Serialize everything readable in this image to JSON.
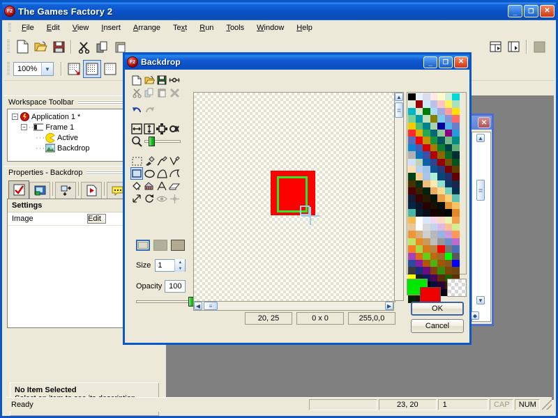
{
  "app": {
    "title": "The Games Factory 2",
    "icon": "app-f2-icon",
    "window_buttons": [
      "minimize",
      "maximize",
      "close"
    ]
  },
  "menubar": {
    "items": [
      {
        "label": "File",
        "mnemonic": "F"
      },
      {
        "label": "Edit",
        "mnemonic": "E"
      },
      {
        "label": "View",
        "mnemonic": "V"
      },
      {
        "label": "Insert",
        "mnemonic": "I"
      },
      {
        "label": "Arrange",
        "mnemonic": "A"
      },
      {
        "label": "Text",
        "mnemonic": "x"
      },
      {
        "label": "Run",
        "mnemonic": "R"
      },
      {
        "label": "Tools",
        "mnemonic": "T"
      },
      {
        "label": "Window",
        "mnemonic": "W"
      },
      {
        "label": "Help",
        "mnemonic": "H"
      }
    ]
  },
  "main_toolbar": {
    "icons": [
      "new-document-icon",
      "open-folder-icon",
      "save-disk-icon",
      "cut-scissors-icon",
      "copy-icon",
      "paste-icon",
      "storyboard-icon",
      "frame-editor-icon",
      "event-editor-icon"
    ],
    "zoom": {
      "value": "100%",
      "dropdown": "chevron-down-icon"
    },
    "grid_buttons": [
      "grid-snap-icon",
      "grid-show-icon",
      "grid-dim-icon"
    ],
    "selected_grid_index": 1
  },
  "workspace": {
    "title": "Workspace Toolbar",
    "tree": [
      {
        "label": "Application 1 *",
        "icon": "application-icon",
        "depth": 0,
        "expander": "-"
      },
      {
        "label": "Frame 1",
        "icon": "frame-icon",
        "depth": 1,
        "expander": "-"
      },
      {
        "label": "Active",
        "icon": "active-object-icon",
        "depth": 2,
        "expander": ""
      },
      {
        "label": "Backdrop",
        "icon": "backdrop-image-icon",
        "depth": 2,
        "expander": ""
      }
    ]
  },
  "properties": {
    "title": "Properties - Backdrop",
    "tabs": [
      {
        "name": "settings-tab",
        "icon": "checklist-icon",
        "selected": true
      },
      {
        "name": "display-tab",
        "icon": "monitor-icon",
        "selected": false
      },
      {
        "name": "movement-tab",
        "icon": "movement-icon",
        "selected": false
      },
      {
        "name": "runtime-tab",
        "icon": "runtime-page-icon",
        "selected": false
      },
      {
        "name": "about-tab",
        "icon": "comment-note-icon",
        "selected": false
      }
    ],
    "section_title": "Settings",
    "rows": [
      {
        "name": "Image",
        "value": "Edit",
        "control": "button"
      }
    ],
    "description": {
      "title": "No Item Selected",
      "subtitle": "Select an item to see its description"
    }
  },
  "statusbar": {
    "message": "Ready",
    "coordinates": "23, 20",
    "layer": "1",
    "caps": "CAP",
    "num": "NUM"
  },
  "backdrop_dialog": {
    "title": "Backdrop",
    "icon": "app-f2-icon",
    "window_buttons": [
      "minimize",
      "maximize",
      "close"
    ],
    "file_tools": [
      "new-icon",
      "open-icon",
      "save-icon",
      "import-icon"
    ],
    "edit_tools": [
      "cut-icon",
      "copy-icon",
      "paste-icon",
      "delete-icon"
    ],
    "history_tools": [
      "undo-icon",
      "redo-icon"
    ],
    "transform_tools": [
      "resize-horizontal-icon",
      "resize-vertical-icon",
      "crop-icon",
      "alpha-icon"
    ],
    "zoom_tool": {
      "icon": "magnifier-icon",
      "slider_value": 15
    },
    "draw_tools": [
      {
        "name": "select-rectangle-icon",
        "selected": false
      },
      {
        "name": "eyedropper-icon",
        "selected": false
      },
      {
        "name": "paintbrush-icon",
        "selected": false
      },
      {
        "name": "pencil-icon",
        "selected": false
      },
      {
        "name": "rectangle-icon",
        "selected": true
      },
      {
        "name": "ellipse-icon",
        "selected": false
      },
      {
        "name": "polygon-icon",
        "selected": false
      },
      {
        "name": "curve-icon",
        "selected": false
      },
      {
        "name": "fill-bucket-icon",
        "selected": false
      },
      {
        "name": "gradient-icon",
        "selected": false
      },
      {
        "name": "text-icon",
        "selected": false
      },
      {
        "name": "eraser-icon",
        "selected": false
      },
      {
        "name": "resize-icon",
        "selected": false
      },
      {
        "name": "rotate-icon",
        "selected": false
      },
      {
        "name": "hide-eye-icon",
        "selected": false
      },
      {
        "name": "sparkle-icon",
        "selected": false
      }
    ],
    "shape_mode": [
      {
        "name": "outline-shape-icon",
        "selected": true
      },
      {
        "name": "filled-shape-icon",
        "selected": false
      },
      {
        "name": "outline-filled-shape-icon",
        "selected": false
      }
    ],
    "size": {
      "label": "Size",
      "value": "1"
    },
    "opacity": {
      "label": "Opacity",
      "value": "100",
      "slider_percent": 100
    },
    "readouts": [
      {
        "name": "cursor-position",
        "value": "20, 25"
      },
      {
        "name": "selection-size",
        "value": "0 x 0"
      },
      {
        "name": "color-rgb",
        "value": "255,0,0"
      }
    ],
    "buttons": [
      {
        "name": "ok-button",
        "label": "OK",
        "default": true
      },
      {
        "name": "cancel-button",
        "label": "Cancel",
        "default": false
      }
    ],
    "colors": {
      "foreground": "#00e800",
      "background": "#ee0000",
      "transparent_label": "transparent-swatch"
    },
    "scrollbars": {
      "vertical": {
        "up": "chevron-up-icon",
        "thumb": "scroll-thumb"
      },
      "horizontal": {
        "left": "chevron-left-icon",
        "right": "chevron-right-icon",
        "thumb": "scroll-thumb"
      }
    },
    "canvas": {
      "drawn_shapes": [
        {
          "name": "red-filled-rectangle",
          "color": "#ff0000"
        },
        {
          "name": "green-outline-rectangle",
          "color": "#22ee22"
        }
      ],
      "cursor": "crosshair-with-box"
    },
    "palette_rows": 24,
    "palette_cols": 8,
    "palette": [
      [
        "#000000",
        "#e8f2fc",
        "#d7dcf0",
        "#ffe8e8",
        "#fffacc",
        "#cceedd",
        "#00d8dc",
        "#dff0dc"
      ],
      [
        "#9c0000",
        "#cfe8fa",
        "#b9c2e8",
        "#ffc4c4",
        "#fff35a",
        "#a8e0c0",
        "#00b9c4",
        "#cfe8cf"
      ],
      [
        "#007a00",
        "#a8dcf5",
        "#a0aade",
        "#ff9c9c",
        "#ffe000",
        "#77d19a",
        "#009aa8",
        "#bfe0bf"
      ],
      [
        "#8a8000",
        "#7fc8ef",
        "#8895d4",
        "#ff6a6a",
        "#f5cc00",
        "#4cbd77",
        "#00818e",
        "#a9d4a9"
      ],
      [
        "#000099",
        "#4fb2e8",
        "#6d7ec8",
        "#ff2a2a",
        "#dfb000",
        "#27a855",
        "#006a74",
        "#8fc898"
      ],
      [
        "#8a0080",
        "#2a9ade",
        "#5a6cbd",
        "#f40000",
        "#c49400",
        "#169440",
        "#00545c",
        "#77bc86"
      ],
      [
        "#008a8a",
        "#0d85d4",
        "#4a5cb2",
        "#d40000",
        "#a87c00",
        "#0b8034",
        "#003f46",
        "#5fb075"
      ],
      [
        "#b0b0b0",
        "#0a72bf",
        "#3d4ea5",
        "#b40000",
        "#8c6600",
        "#066a28",
        "#002e34",
        "#cfe2f5"
      ],
      [
        "#b9d4b2",
        "#0a63a8",
        "#32428f",
        "#970000",
        "#745000",
        "#045420",
        "#fce0b0",
        "#b8cfee"
      ],
      [
        "#9fc4e8",
        "#0a5590",
        "#2a3879",
        "#7a0000",
        "#5c3e00",
        "#034018",
        "#f7cf92",
        "#a9c4ea"
      ],
      [
        "#b2f0d6",
        "#084678",
        "#222e64",
        "#620000",
        "#463000",
        "#023012",
        "#f2bd78",
        "#ffe8b0"
      ],
      [
        "#8fe0cc",
        "#083a63",
        "#1b264f",
        "#4d0000",
        "#342300",
        "#01220c",
        "#efae5e",
        "#ffd98c"
      ],
      [
        "#74d2c0",
        "#06304f",
        "#141c3a",
        "#3a0000",
        "#251900",
        "#011806",
        "#eba048",
        "#fccf78"
      ],
      [
        "#5cc4b4",
        "#05263e",
        "#0e1428",
        "#280000",
        "#180f00",
        "#010f04",
        "#e79436",
        "#f9c462"
      ],
      [
        "#45b6a8",
        "#041c2c",
        "#090d1a",
        "#180000",
        "#0c0700",
        "#000802",
        "#e48726",
        "#f6ba4e"
      ],
      [
        "#ffffff",
        "#d8e8fa",
        "#f0d8f0",
        "#ffd8c0",
        "#e4f5b0",
        "#f2a04a",
        "#e8c89a",
        "#ffffff"
      ],
      [
        "#d8d8d8",
        "#c0d4ee",
        "#e0b8e8",
        "#ffbf90",
        "#d2ee90",
        "#ef9636",
        "#d9b07a",
        "#cfcfcf"
      ],
      [
        "#b8b8b8",
        "#98b4de",
        "#d098dc",
        "#ff9a56",
        "#bee46a",
        "#ec8b22",
        "#c89a5c",
        "#bdbdbd"
      ],
      [
        "#989898",
        "#6c90cc",
        "#bd6ccc",
        "#fa7c22",
        "#a6d845",
        "#d97a18",
        "#b4843f",
        "#ff0000"
      ],
      [
        "#787878",
        "#4a6eb8",
        "#a840bc",
        "#e06a10",
        "#62d016",
        "#c06a10",
        "#9c6e2c",
        "#00ff00"
      ],
      [
        "#585858",
        "#2a4ca0",
        "#8c1ca4",
        "#b4540a",
        "#4ab410",
        "#a05608",
        "#84581c",
        "#0000ff"
      ],
      [
        "#383838",
        "#162f80",
        "#6c0c80",
        "#84400a",
        "#338a0c",
        "#7e4406",
        "#6a4414",
        "#ffff00"
      ],
      [
        "#1c1c1c",
        "#0a1c58",
        "#4a0458",
        "#5a2c06",
        "#205c08",
        "#5c3004",
        "#4e300c",
        "#ff00ff"
      ],
      [
        "#000000",
        "#041038",
        "#2c0234",
        "#3a1c04",
        "#123c04",
        "#3c1e02",
        "#341e06",
        "#00ffff"
      ],
      [
        "#000000",
        "#02081c",
        "#160118",
        "#1e0e02",
        "#082002",
        "#1c0e01",
        "#1a0e02",
        "#ffffff"
      ]
    ]
  },
  "background_window": {
    "name": "frame-editor-window",
    "close_icon": "close-icon",
    "scrollbar": "vertical-scrollbar"
  }
}
